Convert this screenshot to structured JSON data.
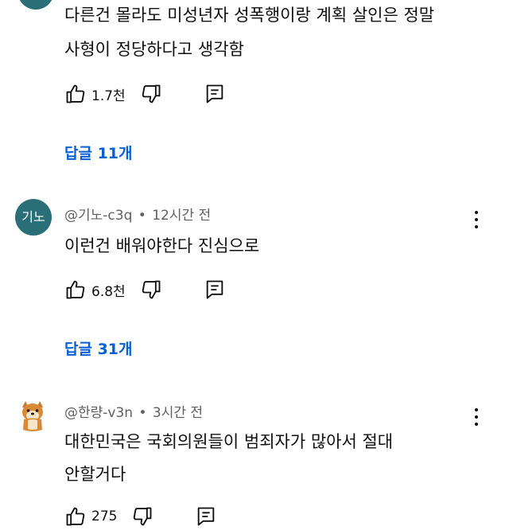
{
  "comments": [
    {
      "lines": [
        "다른건 몰라도 미성년자 성폭행이랑 계획 살인은 정말",
        "사형이 정당하다고 생각함"
      ],
      "likes": "1.7천",
      "replies": "답글 11개"
    },
    {
      "avatar_text": "기노",
      "handle": "@기노-c3q",
      "time": "12시간 전",
      "lines": [
        "이런건 배워야한다 진심으로"
      ],
      "likes": "6.8천",
      "replies": "답글 31개"
    },
    {
      "handle": "@한량-v3n",
      "time": "3시간 전",
      "lines": [
        "대한민국은 국회의원들이 범죄자가 많아서 절대",
        "안할거다"
      ],
      "likes": "275"
    }
  ],
  "separator": "•",
  "colors": {
    "link_blue": "#065fd4",
    "meta_gray": "#606060",
    "avatar_teal": "#2a6f77",
    "text": "#0f0f0f"
  },
  "icons": [
    "like-icon",
    "dislike-icon",
    "reply-icon",
    "more-options-icon"
  ]
}
